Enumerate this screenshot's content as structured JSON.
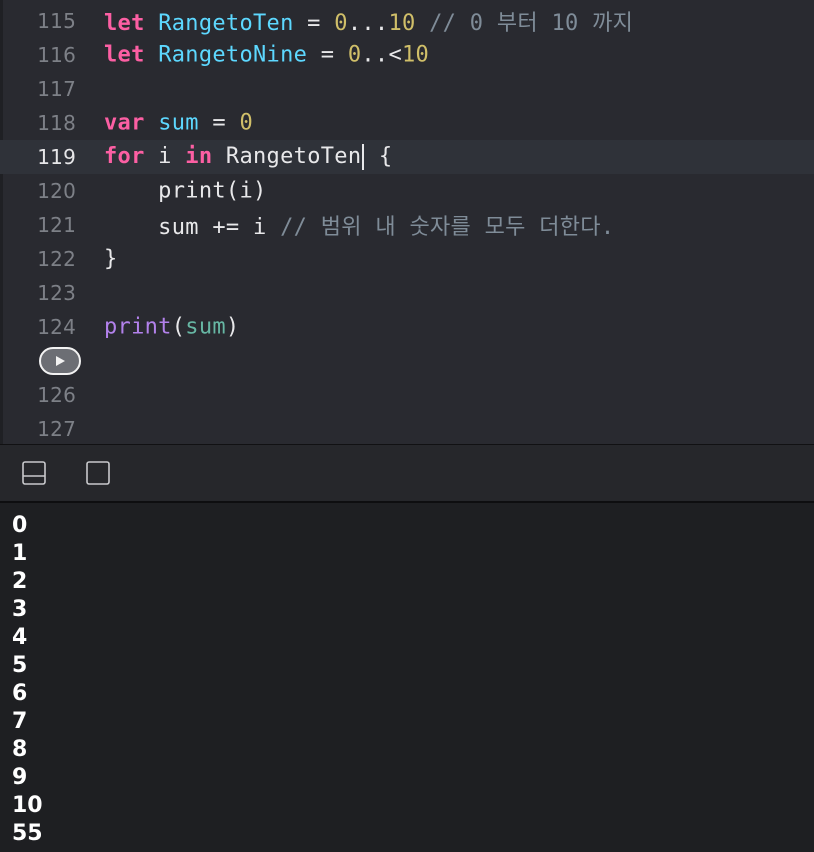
{
  "editor": {
    "current_line": "119",
    "lines": [
      {
        "number": "115",
        "tokens": [
          {
            "t": "kw",
            "v": "let"
          },
          {
            "t": "plain",
            "v": " "
          },
          {
            "t": "type",
            "v": "RangetoTen"
          },
          {
            "t": "plain",
            "v": " = "
          },
          {
            "t": "num",
            "v": "0"
          },
          {
            "t": "plain",
            "v": "..."
          },
          {
            "t": "num",
            "v": "10"
          },
          {
            "t": "plain",
            "v": " "
          },
          {
            "t": "cmt",
            "v": "// 0 부터 10 까지"
          }
        ]
      },
      {
        "number": "116",
        "tokens": [
          {
            "t": "kw",
            "v": "let"
          },
          {
            "t": "plain",
            "v": " "
          },
          {
            "t": "type",
            "v": "RangetoNine"
          },
          {
            "t": "plain",
            "v": " = "
          },
          {
            "t": "num",
            "v": "0"
          },
          {
            "t": "plain",
            "v": "..<"
          },
          {
            "t": "num",
            "v": "10"
          }
        ]
      },
      {
        "number": "117",
        "tokens": []
      },
      {
        "number": "118",
        "tokens": [
          {
            "t": "kw",
            "v": "var"
          },
          {
            "t": "plain",
            "v": " "
          },
          {
            "t": "type",
            "v": "sum"
          },
          {
            "t": "plain",
            "v": " = "
          },
          {
            "t": "num",
            "v": "0"
          }
        ]
      },
      {
        "number": "119",
        "tokens": [
          {
            "t": "kw",
            "v": "for"
          },
          {
            "t": "plain",
            "v": " i "
          },
          {
            "t": "kw",
            "v": "in"
          },
          {
            "t": "plain",
            "v": " RangetoTen"
          },
          {
            "t": "cursor",
            "v": ""
          },
          {
            "t": "plain",
            "v": " {"
          }
        ]
      },
      {
        "number": "120",
        "tokens": [
          {
            "t": "plain",
            "v": "    print(i)"
          }
        ]
      },
      {
        "number": "121",
        "tokens": [
          {
            "t": "plain",
            "v": "    sum += i "
          },
          {
            "t": "cmt",
            "v": "// 범위 내 숫자를 모두 더한다."
          }
        ]
      },
      {
        "number": "122",
        "tokens": [
          {
            "t": "plain",
            "v": "}"
          }
        ]
      },
      {
        "number": "123",
        "tokens": []
      },
      {
        "number": "124",
        "tokens": [
          {
            "t": "fn",
            "v": "print"
          },
          {
            "t": "plain",
            "v": "("
          },
          {
            "t": "var2",
            "v": "sum"
          },
          {
            "t": "plain",
            "v": ")"
          }
        ]
      },
      {
        "number": "",
        "run_button": true,
        "tokens": []
      },
      {
        "number": "126",
        "tokens": []
      },
      {
        "number": "127",
        "tokens": []
      }
    ]
  },
  "debug_bar": {
    "icons": [
      "hide-debug-area-icon",
      "hide-console-icon"
    ]
  },
  "console": {
    "output": [
      "0",
      "1",
      "2",
      "3",
      "4",
      "5",
      "6",
      "7",
      "8",
      "9",
      "10",
      "55"
    ]
  }
}
